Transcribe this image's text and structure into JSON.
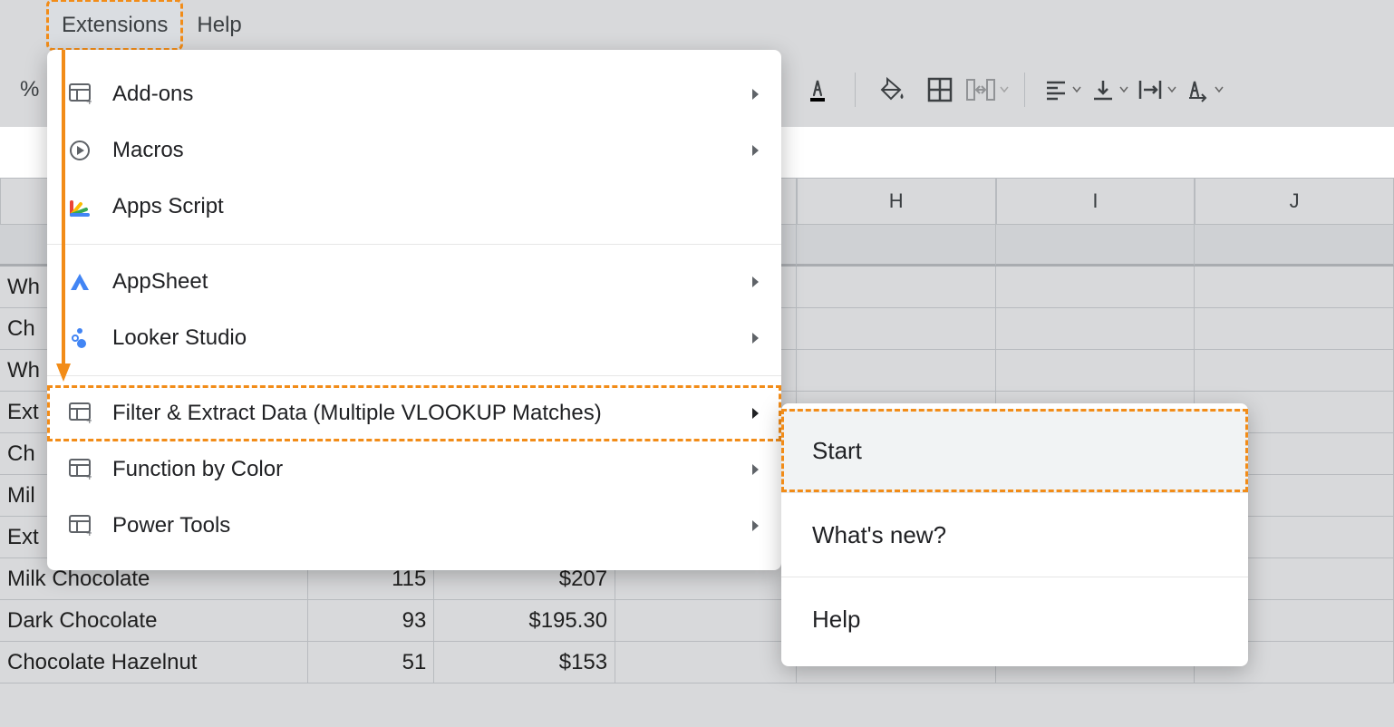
{
  "menubar": {
    "extensions": "Extensions",
    "help": "Help"
  },
  "toolbar": {
    "percent_label": "%"
  },
  "menu": {
    "addons": "Add-ons",
    "macros": "Macros",
    "apps_script": "Apps Script",
    "appsheet": "AppSheet",
    "looker": "Looker Studio",
    "filter_extract": "Filter & Extract Data (Multiple VLOOKUP Matches)",
    "function_by_color": "Function by Color",
    "power_tools": "Power Tools"
  },
  "submenu": {
    "start": "Start",
    "whats_new": "What's new?",
    "help": "Help"
  },
  "columns": {
    "H": "H",
    "I": "I",
    "J": "J"
  },
  "rows": [
    {
      "a": "Wh"
    },
    {
      "a": "Ch"
    },
    {
      "a": "Wh"
    },
    {
      "a": "Ext"
    },
    {
      "a": "Ch"
    },
    {
      "a": "Mil"
    },
    {
      "a": "Ext"
    },
    {
      "a": "Milk Chocolate",
      "b": "115",
      "c": "$207"
    },
    {
      "a": "Dark Chocolate",
      "b": "93",
      "c": "$195.30"
    },
    {
      "a": "Chocolate Hazelnut",
      "b": "51",
      "c": "$153"
    }
  ]
}
